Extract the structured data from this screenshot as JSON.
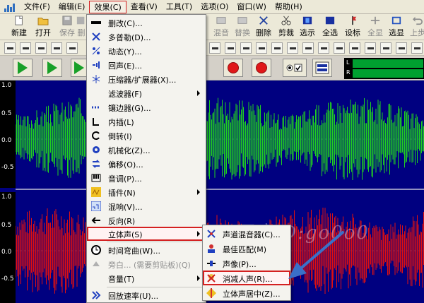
{
  "menubar": {
    "items": [
      "文件(F)",
      "编辑(E)",
      "效果(C)",
      "查看(V)",
      "工具(T)",
      "选项(O)",
      "窗口(W)",
      "帮助(H)"
    ]
  },
  "toolbar": {
    "left": [
      "新建",
      "打开",
      "保存",
      "删"
    ],
    "right": [
      "混音",
      "替换",
      "删除",
      "剪裁",
      "选示",
      "全选",
      "设标",
      "全显",
      "选显",
      "上步"
    ]
  },
  "meters": {
    "left": "L",
    "right": "R"
  },
  "ruler": {
    "top": [
      "1.0",
      "0.5",
      "0.0",
      "-0.5"
    ],
    "bottom": [
      "1.0",
      "0.5",
      "0.0",
      "-0.5"
    ]
  },
  "effects_menu": {
    "items": [
      {
        "label": "删改(C)...",
        "icon": "minus-bar-icon"
      },
      {
        "label": "多普勒(D)...",
        "icon": "doppler-icon"
      },
      {
        "label": "动态(Y)...",
        "icon": "dynamics-icon"
      },
      {
        "label": "回声(E)...",
        "icon": "echo-icon"
      },
      {
        "label": "压缩器/扩展器(X)...",
        "icon": "compressor-icon"
      },
      {
        "label": "滤波器(F)",
        "icon": "",
        "submenu": true
      },
      {
        "label": "镶边器(G)...",
        "icon": "flanger-icon"
      },
      {
        "label": "内插(L)",
        "icon": "interpolate-icon"
      },
      {
        "label": "倒转(I)",
        "icon": "invert-icon"
      },
      {
        "label": "机械化(Z)...",
        "icon": "gear-icon"
      },
      {
        "label": "偏移(O)...",
        "icon": "offset-icon"
      },
      {
        "label": "音调(P)...",
        "icon": "pitch-icon"
      },
      {
        "label": "插件(N)",
        "icon": "plugin-icon",
        "submenu": true
      },
      {
        "label": "混响(V)...",
        "icon": "reverb-icon"
      },
      {
        "label": "反向(R)",
        "icon": "reverse-icon"
      },
      {
        "label": "立体声(S)",
        "icon": "",
        "submenu": true,
        "highlighted": true
      },
      {
        "label": "时间弯曲(W)...",
        "icon": "clock-icon"
      },
      {
        "label": "旁白... (需要剪贴板)(Q)",
        "icon": "voiceover-icon",
        "disabled": true
      },
      {
        "label": "音量(T)",
        "icon": "",
        "submenu": true
      },
      {
        "label": "回放速率(U)...",
        "icon": "playback-rate-icon"
      }
    ]
  },
  "stereo_submenu": {
    "items": [
      {
        "label": "声道混音器(C)...",
        "icon": "channel-mixer-icon"
      },
      {
        "label": "最佳匹配(M)",
        "icon": "best-match-icon"
      },
      {
        "label": "声像(P)...",
        "icon": "pan-icon"
      },
      {
        "label": "消减人声(R)...",
        "icon": "vocal-remove-icon",
        "highlighted": true
      },
      {
        "label": "立体声居中(Z)...",
        "icon": "stereo-center-icon"
      }
    ]
  },
  "watermark": "百度ID:go0o0",
  "colors": {
    "accent": "#d42020",
    "wave_bg": "#000080",
    "wave_green": "#20d020",
    "wave_red": "#e01010",
    "play_green": "#18a028",
    "arrow": "#3a70c8"
  }
}
